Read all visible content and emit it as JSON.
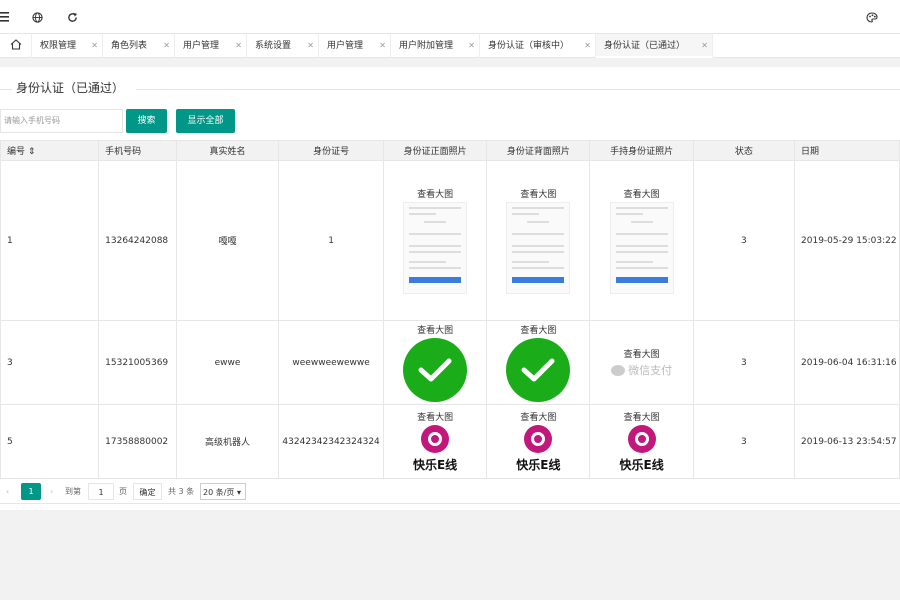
{
  "topbar": {
    "icons": [
      "menu-icon",
      "globe-icon",
      "refresh-icon",
      "palette-icon"
    ]
  },
  "tabs": [
    {
      "label": "权限管理"
    },
    {
      "label": "角色列表"
    },
    {
      "label": "用户管理"
    },
    {
      "label": "系统设置"
    },
    {
      "label": "用户管理"
    },
    {
      "label": "用户附加管理"
    },
    {
      "label": "身份认证（审核中）"
    },
    {
      "label": "身份认证（已通过）"
    }
  ],
  "page": {
    "legend": "身份认证（已通过）",
    "search_placeholder": "请输入手机号码",
    "search_button": "搜索",
    "show_all_button": "显示全部"
  },
  "table": {
    "columns": [
      "编号",
      "手机号码",
      "真实姓名",
      "身份证号",
      "身份证正面照片",
      "身份证背面照片",
      "手持身份证照片",
      "状态",
      "日期"
    ],
    "view_label": "查看大图",
    "wechat_label": "微信支付",
    "logo_label": "快乐E线",
    "rows": [
      {
        "id": "1",
        "phone": "13264242088",
        "name": "嘎嘎",
        "idno": "1",
        "status": "3",
        "date": "2019-05-29 15:03:22"
      },
      {
        "id": "3",
        "phone": "15321005369",
        "name": "ewwe",
        "idno": "weewweewewwe",
        "status": "3",
        "date": "2019-06-04 16:31:16"
      },
      {
        "id": "5",
        "phone": "17358880002",
        "name": "高级机器人",
        "idno": "43242342342324324",
        "status": "3",
        "date": "2019-06-13 23:54:57"
      }
    ]
  },
  "pager": {
    "current": "1",
    "goto_label": "到第",
    "goto_value": "1",
    "page_unit": "页",
    "confirm": "确定",
    "total": "共 3 条",
    "page_size": "20 条/页"
  },
  "colors": {
    "accent": "#009688",
    "check": "#1aad19",
    "logo": "#c2187c"
  }
}
